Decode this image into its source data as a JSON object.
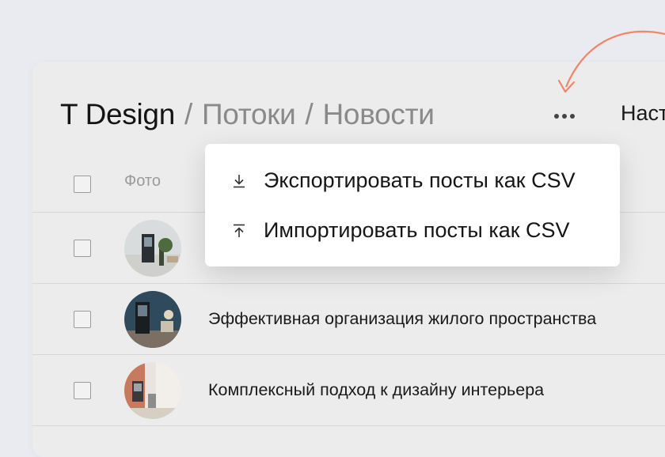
{
  "breadcrumb": {
    "root": "T Design",
    "separator": "/",
    "level1": "Потоки",
    "level2": "Новости"
  },
  "header": {
    "more_icon": "more-horizontal-icon",
    "settings_label": "Наст"
  },
  "table": {
    "photo_column": "Фото",
    "rows": [
      {
        "title": ""
      },
      {
        "title": "Эффективная организация жилого пространства"
      },
      {
        "title": "Комплексный подход к дизайну интерьера"
      }
    ]
  },
  "menu": {
    "items": [
      {
        "label": "Экспортировать посты как CSV",
        "icon": "download-icon"
      },
      {
        "label": "Импортировать посты как CSV",
        "icon": "upload-icon"
      }
    ]
  },
  "colors": {
    "accent_arrow": "#f0866a",
    "background": "#e9ebf0",
    "card": "#ececec"
  }
}
